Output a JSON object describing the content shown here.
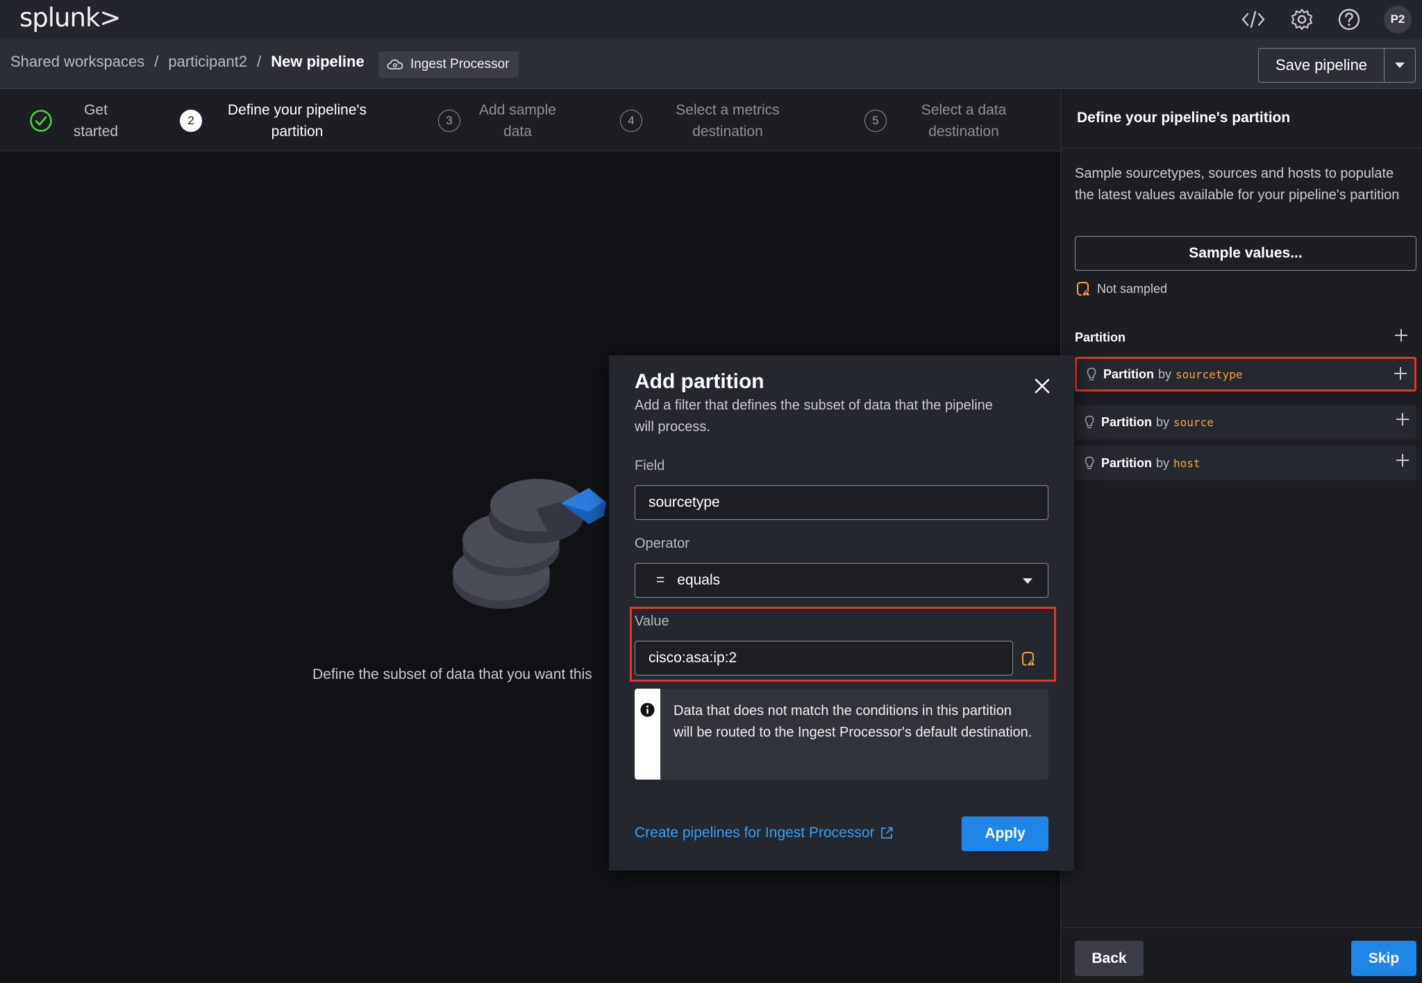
{
  "app": {
    "logo": "splunk>",
    "avatar": "P2"
  },
  "breadcrumb": {
    "items": [
      "Shared workspaces",
      "participant2",
      "New pipeline"
    ],
    "separator": "/",
    "tag": "Ingest Processor"
  },
  "toolbar": {
    "save_label": "Save pipeline"
  },
  "steps": [
    {
      "num": "",
      "label_line1": "Get",
      "label_line2": "started",
      "state": "done"
    },
    {
      "num": "2",
      "label_line1": "Define your pipeline's",
      "label_line2": "partition",
      "state": "active"
    },
    {
      "num": "3",
      "label_line1": "Add sample",
      "label_line2": "data",
      "state": "pending"
    },
    {
      "num": "4",
      "label_line1": "Select a metrics",
      "label_line2": "destination",
      "state": "pending"
    },
    {
      "num": "5",
      "label_line1": "Select a data",
      "label_line2": "destination",
      "state": "pending"
    }
  ],
  "main": {
    "empty_text": "Define the subset of data that you want this"
  },
  "right_panel": {
    "title": "Define your pipeline's partition",
    "description": "Sample sourcetypes, sources and hosts to populate the latest values available for your pipeline's partition",
    "sample_button": "Sample values...",
    "status": "Not sampled",
    "partition_heading": "Partition",
    "partitions": [
      {
        "prefix": "Partition",
        "by": "by",
        "field": "sourcetype",
        "highlighted": true
      },
      {
        "prefix": "Partition",
        "by": "by",
        "field": "source",
        "highlighted": false
      },
      {
        "prefix": "Partition",
        "by": "by",
        "field": "host",
        "highlighted": false
      }
    ],
    "back_label": "Back",
    "skip_label": "Skip"
  },
  "modal": {
    "title": "Add partition",
    "description": "Add a filter that defines the subset of data that the pipeline will process.",
    "field_label": "Field",
    "field_value": "sourcetype",
    "operator_label": "Operator",
    "operator_symbol": "=",
    "operator_value": "equals",
    "value_label": "Value",
    "value_value": "cisco:asa:ip:2",
    "info_text": "Data that does not match the conditions in this partition will be routed to the Ingest Processor's default destination.",
    "link_text": "Create pipelines for Ingest Processor",
    "apply_label": "Apply"
  },
  "colors": {
    "accent": "#1f86e8",
    "highlight": "#e0362b",
    "field_orange": "#f0a449",
    "success": "#4fce3c"
  },
  "icons": [
    "code-icon",
    "gear-icon",
    "help-icon",
    "cloud-icon",
    "chevron-down-icon",
    "check-circle-icon",
    "warning-icon",
    "plus-icon",
    "lightbulb-icon",
    "close-icon",
    "info-icon",
    "external-link-icon"
  ]
}
